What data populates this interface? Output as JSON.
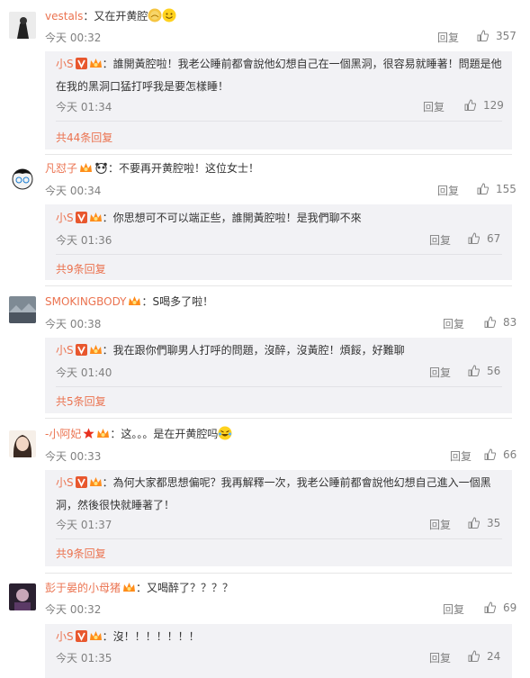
{
  "comments": [
    {
      "user": "vestals",
      "text": "：又在开黄腔",
      "time": "今天 00:32",
      "reply": "回复",
      "likes": "357",
      "sub": {
        "user": "小S",
        "text": "：誰開黃腔啦！我老公睡前都會說他幻想自己在一個黑洞，很容易就睡著！問題是他在我的黑洞口猛打呼我是要怎樣睡！",
        "time": "今天 01:34",
        "reply": "回复",
        "likes": "129",
        "more": "共44条回复"
      }
    },
    {
      "user": "凡怼子",
      "text": "：不要再开黄腔啦！这位女士！",
      "time": "今天 00:34",
      "reply": "回复",
      "likes": "155",
      "sub": {
        "user": "小S",
        "text": "：你思想可不可以端正些，誰開黃腔啦！是我們聊不來",
        "time": "今天 01:36",
        "reply": "回复",
        "likes": "67",
        "more": "共9条回复"
      }
    },
    {
      "user": "SMOKINGBODY",
      "text": "：S喝多了啦！",
      "time": "今天 00:38",
      "reply": "回复",
      "likes": "83",
      "sub": {
        "user": "小S",
        "text": "：我在跟你們聊男人打呼的問題，沒醉，沒黃腔！煩餒，好難聊",
        "time": "今天 01:40",
        "reply": "回复",
        "likes": "56",
        "more": "共5条回复"
      }
    },
    {
      "user": "-小阿妃",
      "text": "：这。。。是在开黄腔吗",
      "time": "今天 00:33",
      "reply": "回复",
      "likes": "66",
      "sub": {
        "user": "小S",
        "text": "：為何大家都思想偏呢？我再解釋一次，我老公睡前都會說他幻想自己進入一個黑洞，然後很快就睡著了！",
        "time": "今天 01:37",
        "reply": "回复",
        "likes": "35",
        "more": "共9条回复"
      }
    },
    {
      "user": "彭于晏的小母猪",
      "text": "：又喝醉了？？？？",
      "time": "今天 00:32",
      "reply": "回复",
      "likes": "69",
      "sub": {
        "user": "小S",
        "text": "：沒！！！！！！！",
        "time": "今天 01:35",
        "reply": "回复",
        "likes": "24",
        "more": ""
      }
    }
  ],
  "colors": {
    "username": "#eb7350",
    "meta": "#808080",
    "subbg": "#f2f2f5"
  },
  "icons": [
    "thumb-up-icon",
    "verified-v-icon",
    "vip-crown-icon",
    "star-icon"
  ]
}
